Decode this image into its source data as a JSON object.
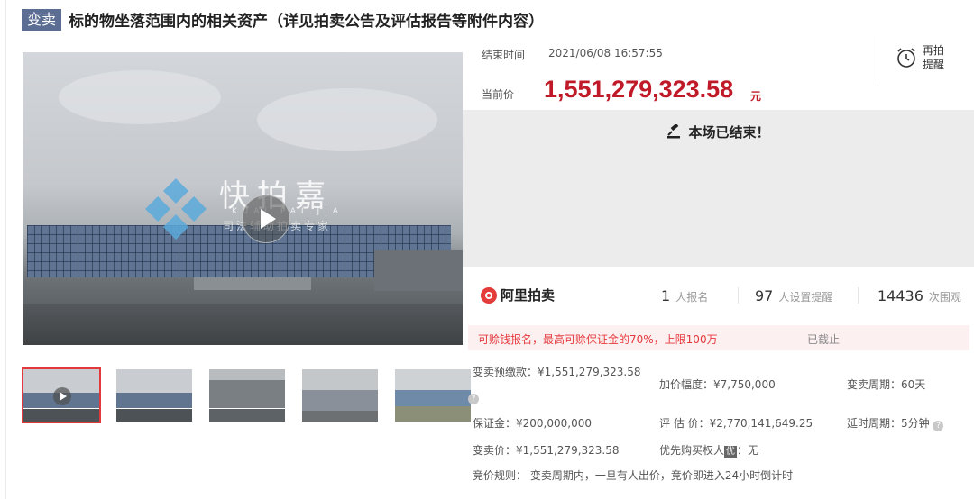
{
  "header": {
    "badge": "变卖",
    "title": "标的物坐落范围内的相关资产（详见拍卖公告及评估报告等附件内容）"
  },
  "media": {
    "watermark_main": "快拍嘉",
    "watermark_pinyin": "KUAI PAI JIA",
    "watermark_slogan": "司法辅助拍卖专家",
    "thumbnail_count": 5,
    "selected_thumbnail": 1
  },
  "auction": {
    "end_label": "结束时间",
    "end_time": "2021/06/08 16:57:55",
    "price_label": "当前价",
    "price": "1,551,279,323.58",
    "price_unit": "元",
    "remind_label": "再拍提醒",
    "ended_message": "本场已结束！"
  },
  "stats": {
    "platform": "阿里拍卖",
    "signups": "1",
    "signups_label": "人报名",
    "reminders": "97",
    "reminders_label": "人设置提醒",
    "views": "14436",
    "views_label": "次围观"
  },
  "loan": {
    "text": "可赊钱报名，最高可赊保证金的70%，上限100万",
    "status": "已截止"
  },
  "details": {
    "prepay": "变卖预缴款：¥1,551,279,323.58",
    "increment": "加价幅度：¥7,750,000",
    "period": "变卖周期：60天",
    "deposit": "保证金：¥200,000,000",
    "appraisal": "评 估 价：¥2,770,141,649.25",
    "delay": "延时周期：5分钟",
    "sale_price": "变卖价：¥1,551,279,323.58",
    "priority_label": "优先购买权人",
    "priority_badge": "优",
    "priority_value": "：无",
    "rule": "竞价规则：  变卖周期内，一旦有人出价，竞价即进入24小时倒计时"
  },
  "colors": {
    "accent_red": "#c01a28",
    "badge_blue": "#5b6d93",
    "loan_bg": "#fdf0f1"
  }
}
